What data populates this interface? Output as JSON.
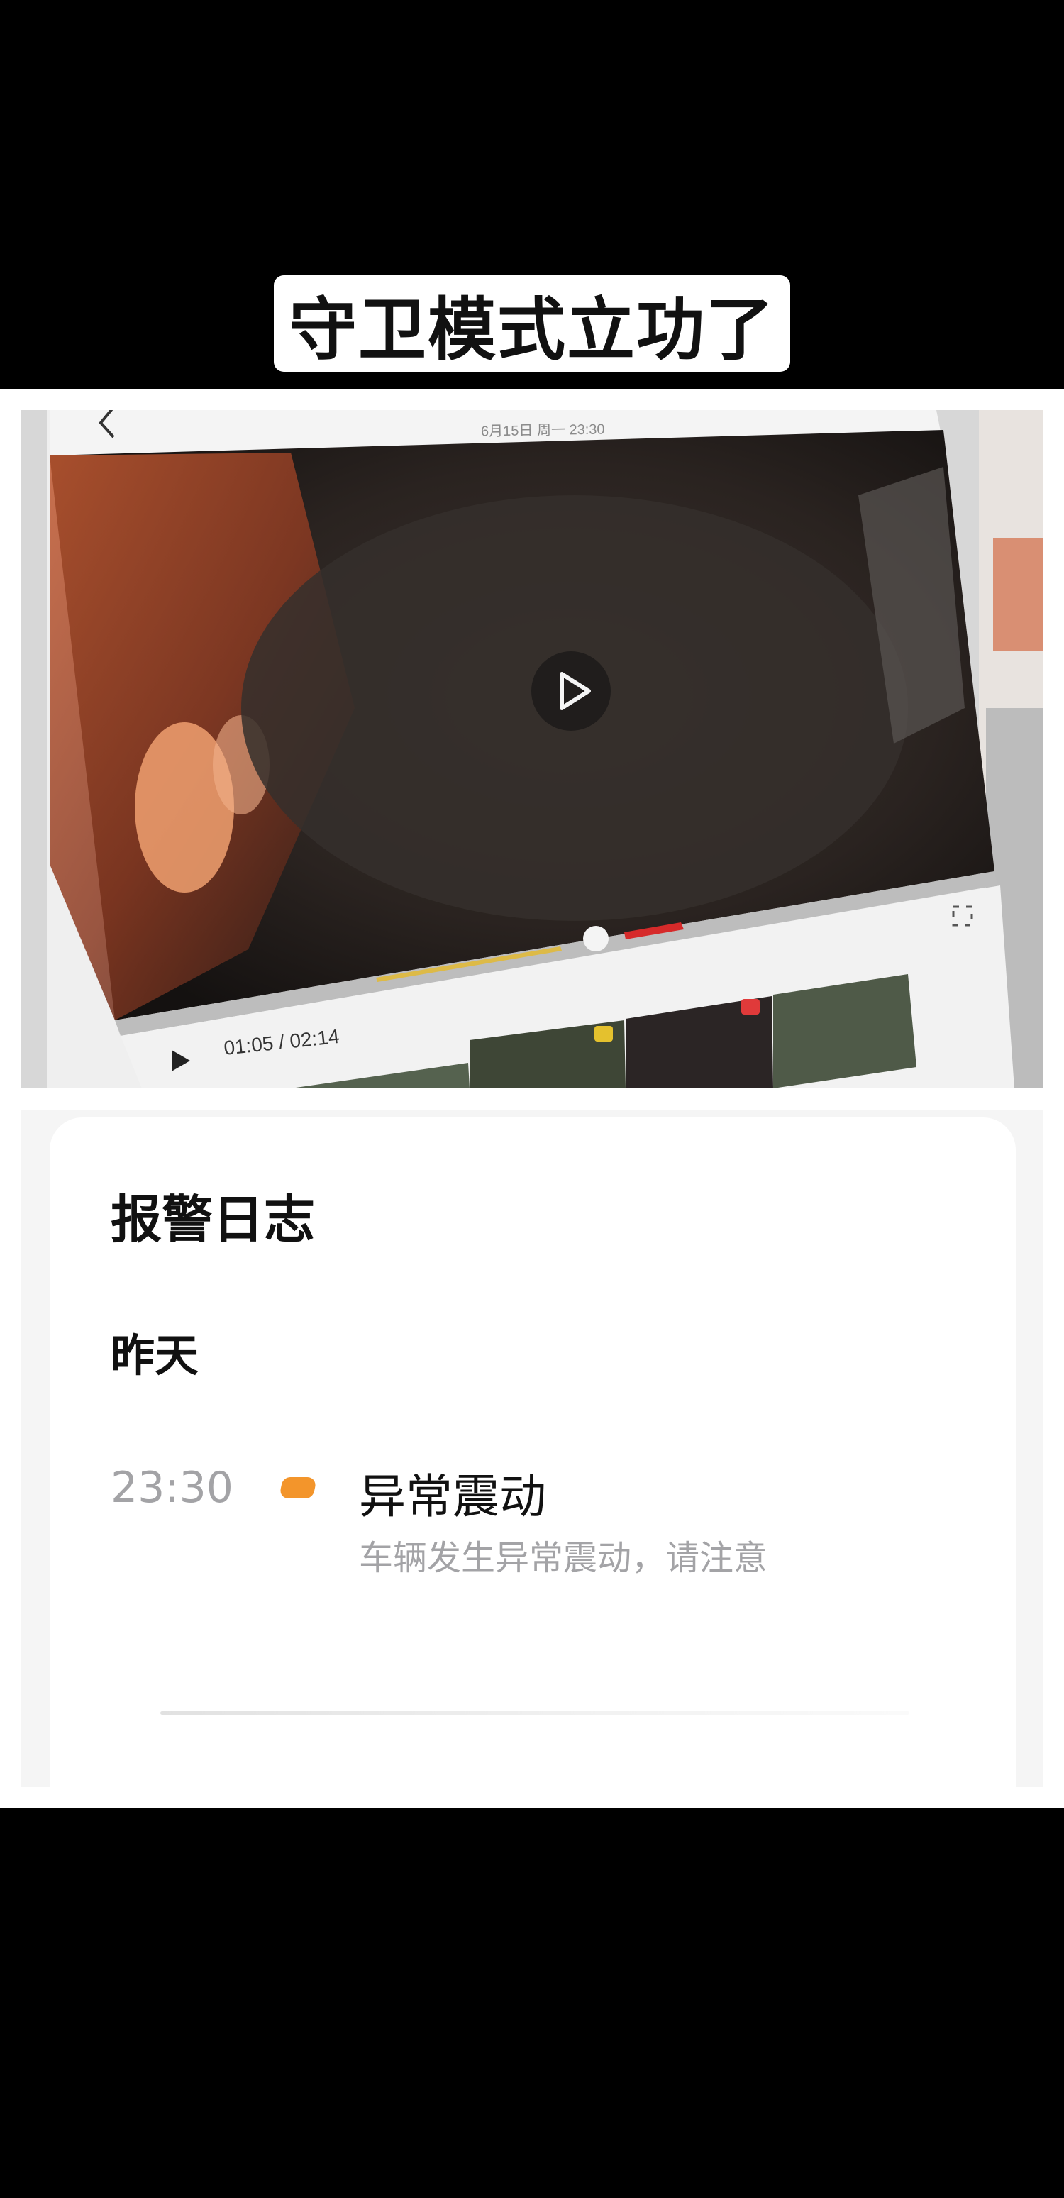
{
  "caption": {
    "text": "守卫模式立功了"
  },
  "video": {
    "date_label": "6月15日 周一 23:30",
    "time_display": "01:05 / 02:14",
    "icons": [
      "back-icon",
      "play-icon",
      "fullscreen-icon",
      "warning-icon"
    ]
  },
  "alarm_log": {
    "title": "报警日志",
    "day": "昨天",
    "events": [
      {
        "time": "23:30",
        "title": "异常震动",
        "description": "车辆发生异常震动，请注意",
        "marker_color": "#f3952b"
      }
    ]
  }
}
